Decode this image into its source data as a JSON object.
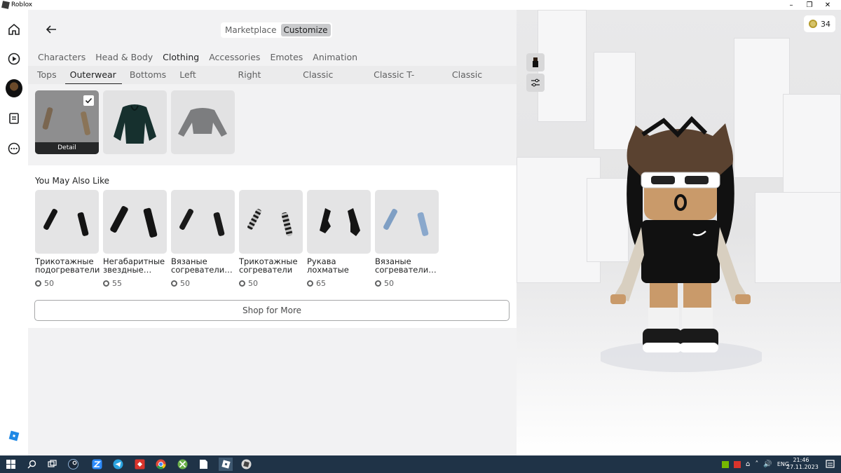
{
  "window": {
    "title": "Roblox",
    "minimize": "–",
    "restore": "❐",
    "close": "✕"
  },
  "rail": {
    "items": [
      {
        "name": "home-icon"
      },
      {
        "name": "play-icon"
      },
      {
        "name": "avatar-icon"
      },
      {
        "name": "chat-icon"
      },
      {
        "name": "more-icon"
      }
    ],
    "logo": "roblox-logo-icon"
  },
  "topbar": {
    "modes": [
      {
        "label": "Marketplace",
        "active": false
      },
      {
        "label": "Customize",
        "active": true
      }
    ]
  },
  "categories": [
    {
      "label": "Characters",
      "active": false
    },
    {
      "label": "Head & Body",
      "active": false
    },
    {
      "label": "Clothing",
      "active": true
    },
    {
      "label": "Accessories",
      "active": false
    },
    {
      "label": "Emotes",
      "active": false
    },
    {
      "label": "Animation",
      "active": false
    }
  ],
  "subcategories": [
    {
      "label": "Tops",
      "active": false
    },
    {
      "label": "Outerwear",
      "active": true
    },
    {
      "label": "Bottoms",
      "active": false
    },
    {
      "label": "Left Shoes",
      "active": false
    },
    {
      "label": "Right Shoes",
      "active": false
    },
    {
      "label": "Classic Shirts",
      "active": false
    },
    {
      "label": "Classic T-Shirts",
      "active": false
    },
    {
      "label": "Classic Pants",
      "active": false
    }
  ],
  "owned_items": [
    {
      "kind": "sleeves-brown",
      "selected": true,
      "detail_label": "Detail"
    },
    {
      "kind": "jacket-green",
      "selected": false
    },
    {
      "kind": "sweater-gray",
      "selected": false
    }
  ],
  "suggestions": {
    "title": "You May Also Like",
    "items": [
      {
        "name": "Трикотажные подогреватели",
        "price": "50",
        "style": "black"
      },
      {
        "name": "Негабаритные звездные…",
        "price": "55",
        "style": "black"
      },
      {
        "name": "Вязаные согреватели…",
        "price": "50",
        "style": "black"
      },
      {
        "name": "Трикотажные согреватели",
        "price": "50",
        "style": "striped"
      },
      {
        "name": "Рукава лохматые",
        "price": "65",
        "style": "fluffy"
      },
      {
        "name": "Вязаные согреватели…",
        "price": "50",
        "style": "blue"
      }
    ],
    "shop_more": "Shop for More"
  },
  "viewport": {
    "robux": "34"
  },
  "taskbar": {
    "lang": "ENG",
    "time": "21:46",
    "date": "27.11.2023"
  },
  "colors": {
    "accent_dark": "#202122",
    "panel": "#f2f2f3",
    "taskbar": "#1f3347"
  }
}
